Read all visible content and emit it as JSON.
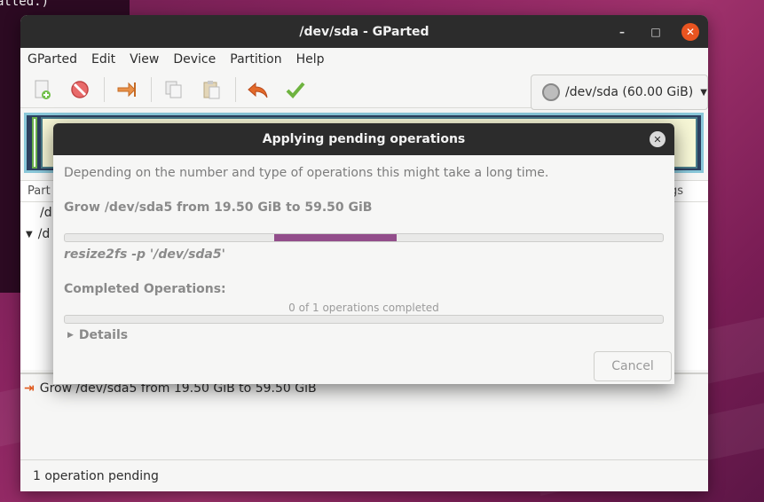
{
  "terminal": {
    "text": "atted.)"
  },
  "window": {
    "title": "/dev/sda - GParted",
    "controls": {
      "minimize": "–",
      "maximize": "□",
      "close": "✕"
    }
  },
  "menubar": {
    "items": [
      "GParted",
      "Edit",
      "View",
      "Device",
      "Partition",
      "Help"
    ]
  },
  "toolbar": {
    "device_selector": "/dev/sda (60.00 GiB)"
  },
  "partition_list": {
    "header_left": "Part",
    "header_right": "gs",
    "rows": [
      "/d",
      "/d"
    ]
  },
  "operations": {
    "items": [
      "Grow /dev/sda5 from 19.50 GiB to 59.50 GiB"
    ]
  },
  "statusbar": {
    "text": "1 operation pending"
  },
  "dialog": {
    "title": "Applying pending operations",
    "description": "Depending on the number and type of operations this might take a long time.",
    "current_operation": "Grow /dev/sda5 from 19.50 GiB to 59.50 GiB",
    "command": "resize2fs -p '/dev/sda5'",
    "completed_label": "Completed Operations:",
    "completed_count": "0 of 1 operations completed",
    "details_label": "Details",
    "cancel_label": "Cancel",
    "activity_bar": {
      "start_fraction": 0.35,
      "end_fraction": 0.555
    }
  },
  "colors": {
    "accent_progress": "#924d8b",
    "close_button": "#e95420",
    "titlebar": "#2c2c2c"
  }
}
